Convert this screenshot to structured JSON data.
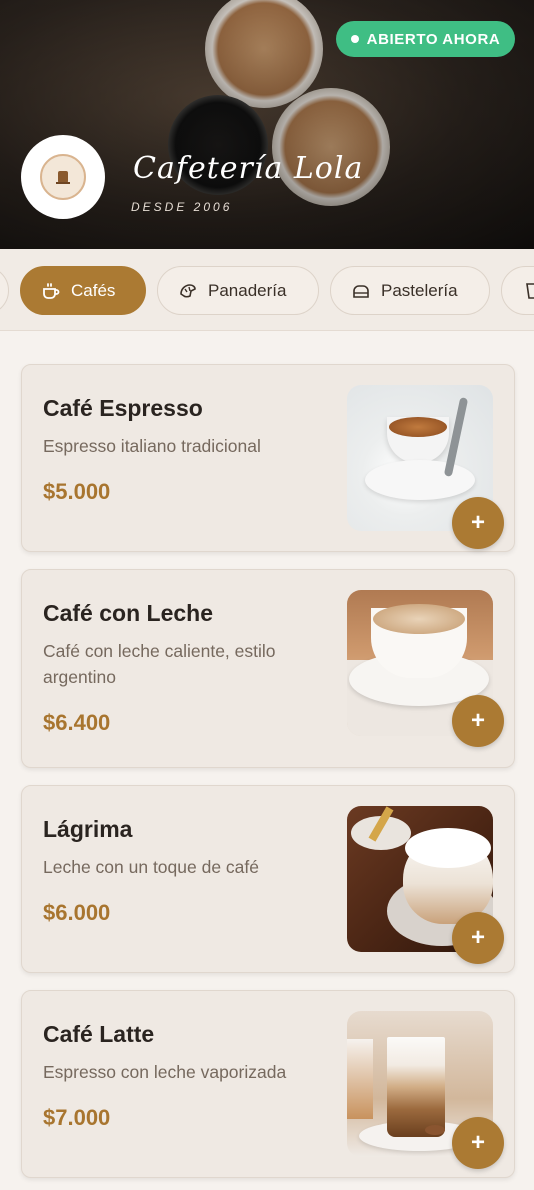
{
  "hero": {
    "status": "ABIERTO AHORA",
    "name": "Cafetería Lola",
    "since": "DESDE 2006"
  },
  "tabs": [
    {
      "label": "",
      "icon": "partial-tab"
    },
    {
      "label": "Cafés",
      "icon": "coffee-cup-icon",
      "active": true
    },
    {
      "label": "Panadería",
      "icon": "croissant-icon"
    },
    {
      "label": "Pastelería",
      "icon": "cake-icon"
    },
    {
      "label": "",
      "icon": "glass-icon"
    }
  ],
  "products": [
    {
      "name": "Café Espresso",
      "description": "Espresso italiano tradicional",
      "price": "$5.000",
      "add_label": "+"
    },
    {
      "name": "Café con Leche",
      "description": "Café con leche caliente, estilo argentino",
      "price": "$6.400",
      "add_label": "+"
    },
    {
      "name": "Lágrima",
      "description": "Leche con un toque de café",
      "price": "$6.000",
      "add_label": "+"
    },
    {
      "name": "Café Latte",
      "description": "Espresso con leche vaporizada",
      "price": "$7.000",
      "add_label": "+"
    }
  ],
  "colors": {
    "accent": "#ab7a33",
    "status": "#3fbe84",
    "background": "#f6f2ee"
  }
}
